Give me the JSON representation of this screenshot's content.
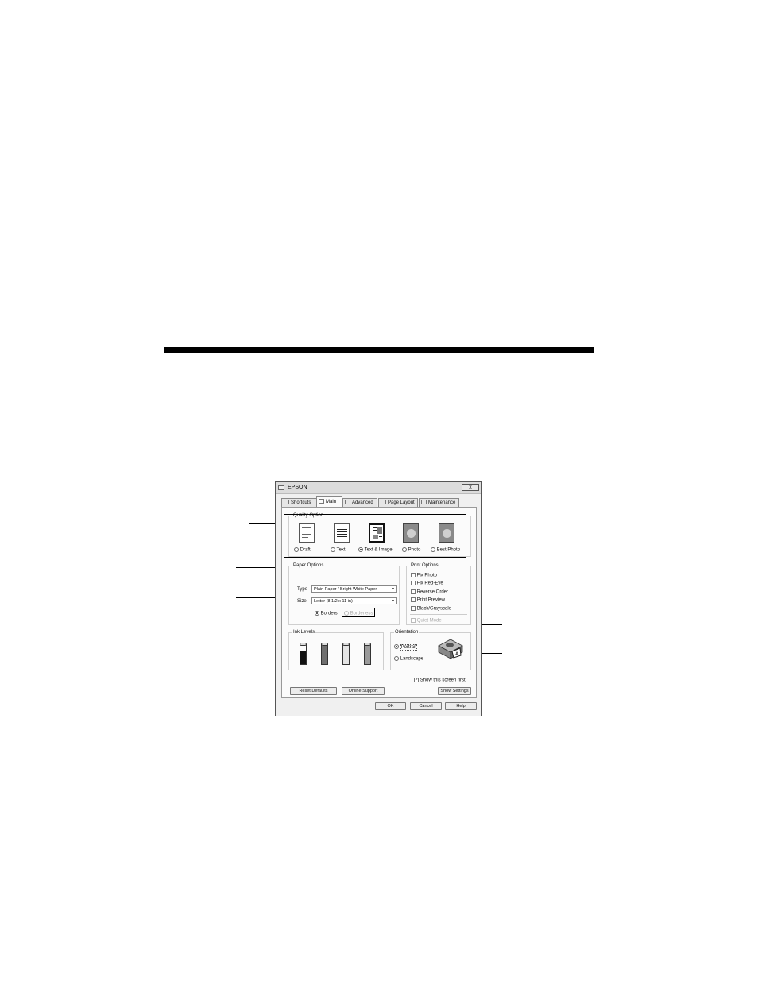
{
  "window": {
    "title": "EPSON",
    "close_glyph": "x"
  },
  "tabs": [
    {
      "label": "Shortcuts",
      "icon": "star-icon"
    },
    {
      "label": "Main",
      "icon": "printer-icon",
      "active": true
    },
    {
      "label": "Advanced",
      "icon": "gear-icon"
    },
    {
      "label": "Page Layout",
      "icon": "page-icon"
    },
    {
      "label": "Maintenance",
      "icon": "wrench-icon"
    }
  ],
  "quality": {
    "label": "Quality Option",
    "options": [
      {
        "label": "Draft",
        "selected": false
      },
      {
        "label": "Text",
        "selected": false
      },
      {
        "label": "Text & Image",
        "selected": true
      },
      {
        "label": "Photo",
        "selected": false
      },
      {
        "label": "Best Photo",
        "selected": false
      }
    ]
  },
  "paper": {
    "label": "Paper Options",
    "type_label": "Type",
    "type_value": "Plain Paper / Bright White Paper",
    "size_label": "Size",
    "size_value": "Letter (8 1/2 x 11 in)",
    "borders_label": "Borders",
    "borderless_label": "Borderless"
  },
  "print_options": {
    "label": "Print Options",
    "items": [
      "Fix Photo",
      "Fix Red-Eye",
      "Reverse Order",
      "Print Preview",
      "Black/Grayscale"
    ],
    "quiet_mode": "Quiet Mode"
  },
  "ink": {
    "label": "Ink Levels",
    "cartridges": [
      {
        "color": "black",
        "level": 0.72
      },
      {
        "color": "cyan",
        "level": 0.95
      },
      {
        "color": "yellow",
        "level": 0.95
      },
      {
        "color": "magenta",
        "level": 0.95
      }
    ]
  },
  "orientation": {
    "label": "Orientation",
    "portrait": "Portrait",
    "landscape": "Landscape",
    "selected": "Portrait"
  },
  "show_screen_first": {
    "label": "Show this screen first",
    "checked": true
  },
  "buttons": {
    "reset_defaults": "Reset Defaults",
    "online_support": "Online Support",
    "show_settings": "Show Settings",
    "ok": "OK",
    "cancel": "Cancel",
    "help": "Help"
  }
}
